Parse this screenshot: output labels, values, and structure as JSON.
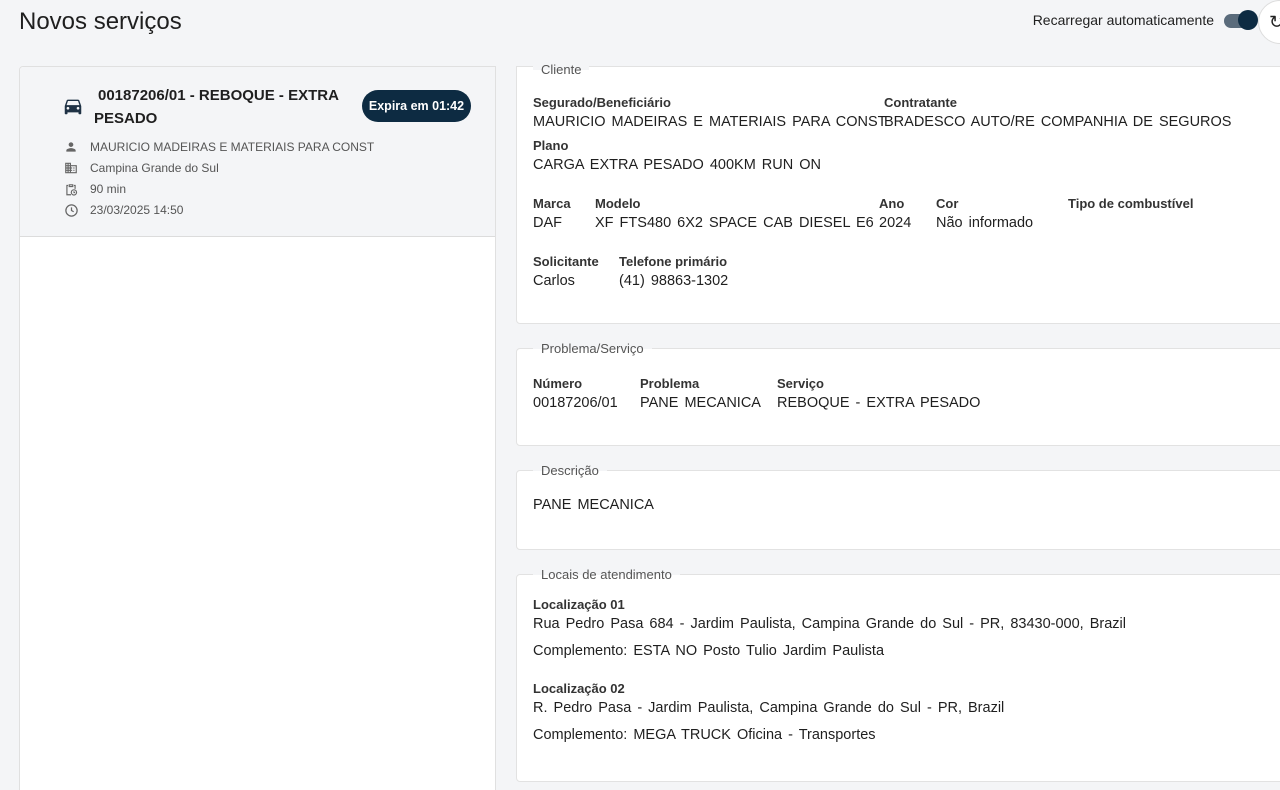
{
  "header": {
    "title": "Novos serviços",
    "auto_reload_label": "Recarregar automaticamente",
    "auto_reload_on": true
  },
  "service_card": {
    "icon": "car-icon",
    "title_line1": "00187206/01 - REBOQUE - EXTRA",
    "title_line2": "PESADO",
    "badge": "Expira em 01:42",
    "client": "MAURICIO MADEIRAS E MATERIAIS PARA CONST",
    "city": "Campina Grande do Sul",
    "duration": "90 min",
    "datetime": "23/03/2025 14:50"
  },
  "cliente": {
    "legend": "Cliente",
    "segurado_label": "Segurado/Beneficiário",
    "segurado_value": "MAURICIO MADEIRAS E MATERIAIS PARA CONST",
    "contratante_label": "Contratante",
    "contratante_value": "BRADESCO AUTO/RE COMPANHIA DE SEGUROS",
    "plano_label": "Plano",
    "plano_value": "CARGA EXTRA PESADO 400KM RUN ON",
    "marca_label": "Marca",
    "marca_value": "DAF",
    "modelo_label": "Modelo",
    "modelo_value": "XF FTS480 6X2 SPACE CAB DIESEL E6",
    "ano_label": "Ano",
    "ano_value": "2024",
    "cor_label": "Cor",
    "cor_value": "Não informado",
    "combustivel_label": "Tipo de combustível",
    "solicitante_label": "Solicitante",
    "solicitante_value": "Carlos",
    "telefone_label": "Telefone primário",
    "telefone_value": "(41) 98863-1302"
  },
  "problema": {
    "legend": "Problema/Serviço",
    "numero_label": "Número",
    "numero_value": "00187206/01",
    "problema_label": "Problema",
    "problema_value": "PANE MECANICA",
    "servico_label": "Serviço",
    "servico_value": "REBOQUE - EXTRA PESADO"
  },
  "descricao": {
    "legend": "Descrição",
    "text": "PANE MECANICA"
  },
  "locais": {
    "legend": "Locais de atendimento",
    "items": [
      {
        "label": "Localização 01",
        "address": "Rua Pedro Pasa 684 - Jardim Paulista, Campina Grande do Sul - PR, 83430-000, Brazil",
        "complement": "Complemento: ESTA NO Posto Tulio Jardim Paulista"
      },
      {
        "label": "Localização 02",
        "address": "R. Pedro Pasa - Jardim Paulista, Campina Grande do Sul - PR, Brazil",
        "complement": "Complemento: MEGA TRUCK Oficina - Transportes"
      }
    ]
  },
  "colors": {
    "accent": "#0d2b42",
    "background": "#f4f5f7"
  }
}
